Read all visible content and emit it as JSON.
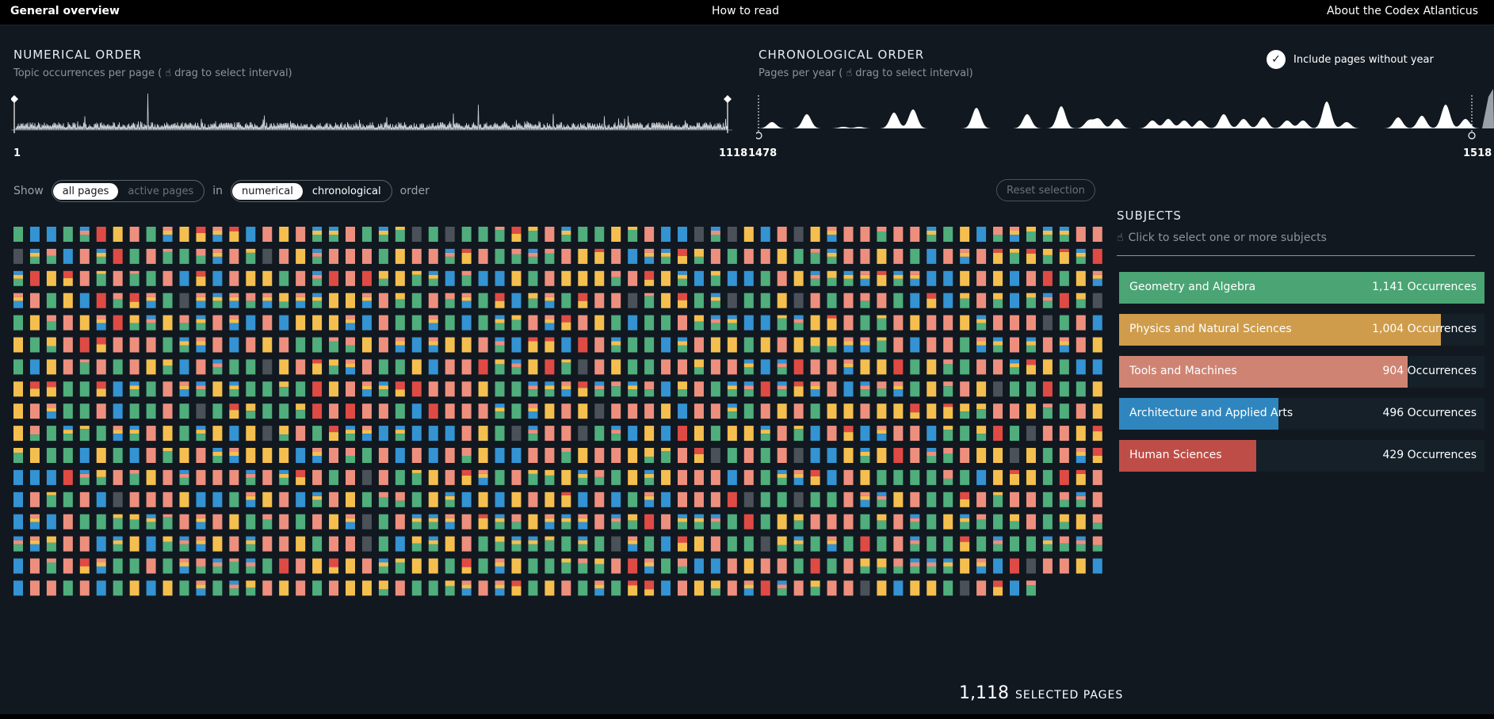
{
  "nav": {
    "overview": "General overview",
    "how_to_read": "How to read",
    "about": "About the Codex Atlanticus"
  },
  "numerical": {
    "title": "NUMERICAL ORDER",
    "subtitle_pre": "Topic occurrences per page (",
    "subtitle_post": "drag to select interval)",
    "range_start": "1",
    "range_end": "1118"
  },
  "chronological": {
    "title": "CHRONOLOGICAL ORDER",
    "subtitle_pre": "Pages per year (",
    "subtitle_post": "drag to select interval)",
    "range_start": "1478",
    "range_end": "1518",
    "include_label": "Include pages without year",
    "include_checked": true
  },
  "controls": {
    "show": "Show",
    "all_pages": "all pages",
    "active_pages": "active pages",
    "in": "in",
    "numerical": "numerical",
    "chronological": "chronological",
    "order": "order",
    "reset": "Reset selection"
  },
  "subjects": {
    "title": "SUBJECTS",
    "hint": "Click to select one or more subjects",
    "items": [
      {
        "name": "Geometry and Algebra",
        "occurrences": "1,141 Occurrences",
        "color": "#4aa474",
        "share": 1.0
      },
      {
        "name": "Physics and Natural Sciences",
        "occurrences": "1,004 Occurrences",
        "color": "#cf9c4b",
        "share": 0.88
      },
      {
        "name": "Tools and Machines",
        "occurrences": "904 Occurrences",
        "color": "#cf8473",
        "share": 0.79
      },
      {
        "name": "Architecture and Applied Arts",
        "occurrences": "496 Occurrences",
        "color": "#2f86bf",
        "share": 0.435
      },
      {
        "name": "Human Sciences",
        "occurrences": "429 Occurrences",
        "color": "#bf4d47",
        "share": 0.376
      }
    ]
  },
  "footer": {
    "count": "1,118",
    "label": "SELECTED PAGES"
  },
  "palette": {
    "green": "#4fae7c",
    "yellow": "#f5bf4f",
    "salmon": "#ee8f7e",
    "blue": "#3493d2",
    "red": "#df4b44",
    "gray": "#4a5159"
  },
  "grid": {
    "total_pages": 1118,
    "columns": 66
  }
}
